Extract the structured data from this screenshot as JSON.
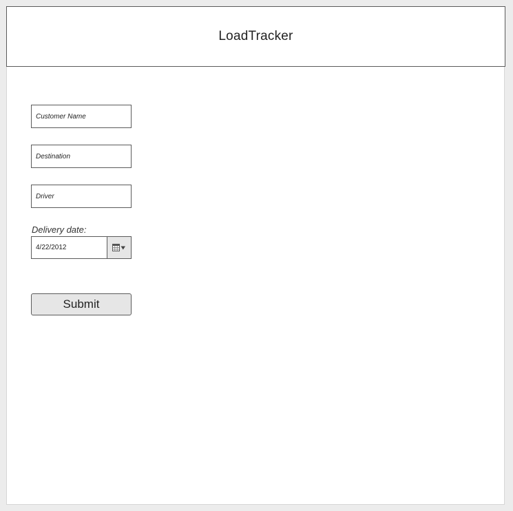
{
  "header": {
    "title": "LoadTracker"
  },
  "form": {
    "customer_name": {
      "placeholder": "Customer Name",
      "value": ""
    },
    "destination": {
      "placeholder": "Destination",
      "value": ""
    },
    "driver": {
      "placeholder": "Driver",
      "value": ""
    },
    "delivery_date": {
      "label": "Delivery date:",
      "value": "4/22/2012",
      "icon": "calendar-dropdown-icon"
    },
    "submit_label": "Submit"
  },
  "colors": {
    "page_background": "#ececec",
    "canvas_background": "#ffffff",
    "border": "#5a5a5a",
    "button_fill": "#e6e6e6",
    "text": "#222222"
  }
}
